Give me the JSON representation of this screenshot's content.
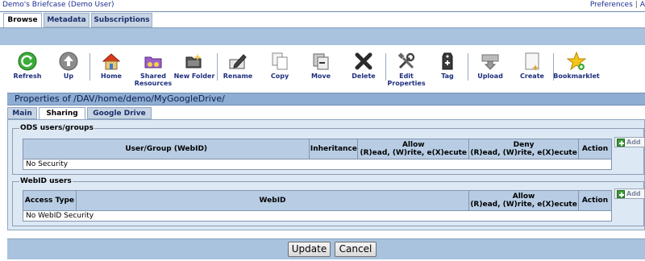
{
  "header": {
    "app_title": "Demo's Briefcase",
    "user": "(Demo User)",
    "preferences_link": "Preferences",
    "separator": "|",
    "truncated_link": "A"
  },
  "main_tabs": [
    {
      "label": "Browse",
      "active": true
    },
    {
      "label": "Metadata",
      "active": false
    },
    {
      "label": "Subscriptions",
      "active": false
    }
  ],
  "toolbar": {
    "refresh": "Refresh",
    "up": "Up",
    "home": "Home",
    "shared_1": "Shared",
    "shared_2": "Resources",
    "new_folder": "New Folder",
    "rename": "Rename",
    "copy": "Copy",
    "move": "Move",
    "delete": "Delete",
    "edit_1": "Edit",
    "edit_2": "Properties",
    "tag": "Tag",
    "upload": "Upload",
    "create": "Create",
    "bookmarklet": "Bookmarklet"
  },
  "properties_title": "Properties of /DAV/home/demo/MyGoogleDrive/",
  "sub_tabs": [
    {
      "label": "Main",
      "active": false
    },
    {
      "label": "Sharing",
      "active": true
    },
    {
      "label": "Google Drive",
      "active": false
    }
  ],
  "ods_section": {
    "legend": "ODS users/groups",
    "columns": {
      "user_group": "User/Group (WebID)",
      "inheritance": "Inheritance",
      "allow_1": "Allow",
      "allow_2": "(R)ead, (W)rite, e(X)ecute",
      "deny_1": "Deny",
      "deny_2": "(R)ead, (W)rite, e(X)ecute",
      "action": "Action"
    },
    "empty_text": "No Security",
    "add_label": "Add"
  },
  "webid_section": {
    "legend": "WebID users",
    "columns": {
      "access_type": "Access Type",
      "webid": "WebID",
      "allow_1": "Allow",
      "allow_2": "(R)ead, (W)rite, e(X)ecute",
      "action": "Action"
    },
    "empty_text": "No WebID Security",
    "add_label": "Add"
  },
  "buttons": {
    "update": "Update",
    "cancel": "Cancel"
  },
  "colors": {
    "band": "#a9c2dd",
    "panel": "#dce8f4",
    "header_cell": "#b8cde4",
    "toolbar_text": "#1e2f7d"
  }
}
